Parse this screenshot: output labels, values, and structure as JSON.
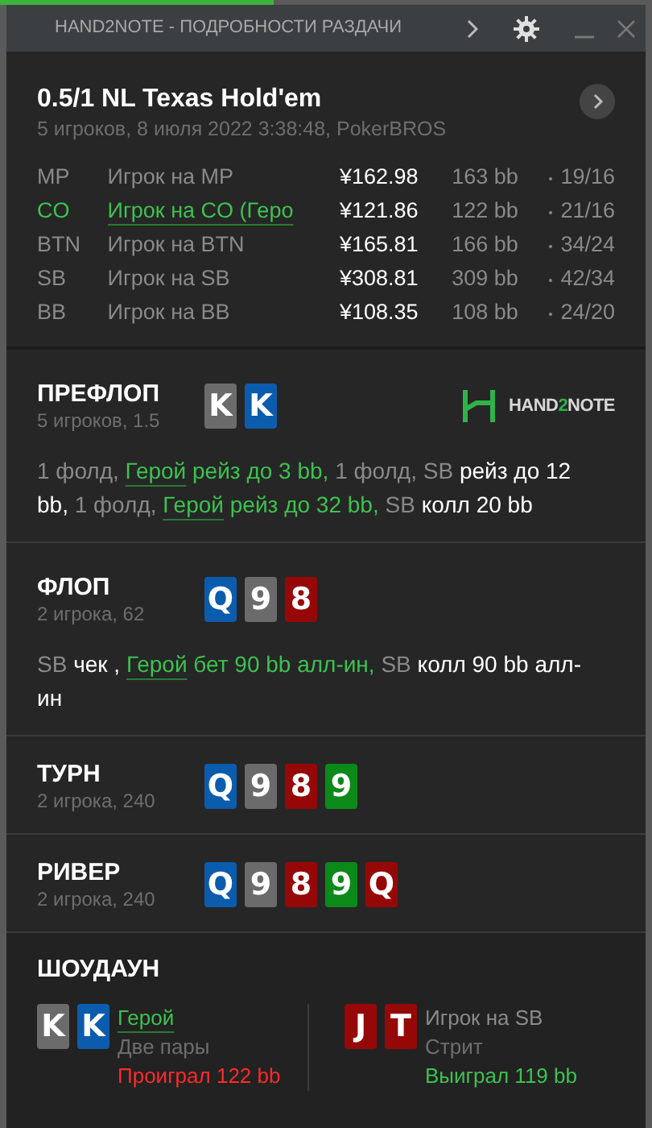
{
  "window": {
    "title": "HAND2NOTE - ПОДРОБНОСТИ РАЗДАЧИ"
  },
  "header": {
    "title": "0.5/1 NL Texas Hold'em",
    "subtitle": "5 игроков, 8 июля 2022 3:38:48, PokerBROS"
  },
  "players": [
    {
      "position": "MP",
      "name": "Игрок на MP",
      "hero": false,
      "stack": "¥162.98",
      "bb": "163 bb",
      "stats": "19/16"
    },
    {
      "position": "CO",
      "name": "Игрок на CO (Геро",
      "hero": true,
      "stack": "¥121.86",
      "bb": "122 bb",
      "stats": "21/16"
    },
    {
      "position": "BTN",
      "name": "Игрок на BTN",
      "hero": false,
      "stack": "¥165.81",
      "bb": "166 bb",
      "stats": "34/24"
    },
    {
      "position": "SB",
      "name": "Игрок на SB",
      "hero": false,
      "stack": "¥308.81",
      "bb": "309 bb",
      "stats": "42/34"
    },
    {
      "position": "BB",
      "name": "Игрок на BB",
      "hero": false,
      "stack": "¥108.35",
      "bb": "108 bb",
      "stats": "24/20"
    }
  ],
  "logo": [
    {
      "text": "HAND",
      "accent": false
    },
    {
      "text": "2",
      "accent": true
    },
    {
      "text": "NOTE",
      "accent": false
    }
  ],
  "streets": [
    {
      "name": "ПРЕФЛОП",
      "info": "5 игроков, 1.5",
      "show_logo": true,
      "cards": [
        {
          "rank": "K",
          "color": "#6b6b6b"
        },
        {
          "rank": "K",
          "color": "#0b5cad"
        }
      ],
      "actions": [
        {
          "text": "1 фолд,",
          "kind": "player"
        },
        {
          "text": "Герой",
          "kind": "hero"
        },
        {
          "text": "рейз до 3 bb,",
          "kind": "hero_action"
        },
        {
          "text": "1 фолд, SB",
          "kind": "player"
        },
        {
          "text": "рейз до 12 bb,",
          "kind": "action"
        },
        {
          "text": "1 фолд,",
          "kind": "player"
        },
        {
          "text": "Герой",
          "kind": "hero"
        },
        {
          "text": "рейз до 32 bb,",
          "kind": "hero_action"
        },
        {
          "text": "SB",
          "kind": "player"
        },
        {
          "text": "колл 20 bb",
          "kind": "action"
        }
      ]
    },
    {
      "name": "ФЛОП",
      "info": "2 игрока, 62",
      "show_logo": false,
      "cards": [
        {
          "rank": "Q",
          "color": "#0b5cad"
        },
        {
          "rank": "9",
          "color": "#6b6b6b"
        },
        {
          "rank": "8",
          "color": "#960808"
        }
      ],
      "actions": [
        {
          "text": "SB",
          "kind": "player"
        },
        {
          "text": "чек ,",
          "kind": "action"
        },
        {
          "text": "Герой",
          "kind": "hero"
        },
        {
          "text": "бет 90 bb алл-ин,",
          "kind": "hero_action"
        },
        {
          "text": "SB",
          "kind": "player"
        },
        {
          "text": "колл 90 bb алл-ин",
          "kind": "action"
        }
      ]
    },
    {
      "name": "ТУРН",
      "info": "2 игрока, 240",
      "show_logo": false,
      "cards": [
        {
          "rank": "Q",
          "color": "#0b5cad"
        },
        {
          "rank": "9",
          "color": "#6b6b6b"
        },
        {
          "rank": "8",
          "color": "#960808"
        },
        {
          "rank": "9",
          "color": "#0b8a1a"
        }
      ]
    },
    {
      "name": "РИВЕР",
      "info": "2 игрока, 240",
      "show_logo": false,
      "cards": [
        {
          "rank": "Q",
          "color": "#0b5cad"
        },
        {
          "rank": "9",
          "color": "#6b6b6b"
        },
        {
          "rank": "8",
          "color": "#960808"
        },
        {
          "rank": "9",
          "color": "#0b8a1a"
        },
        {
          "rank": "Q",
          "color": "#960808"
        }
      ]
    }
  ],
  "showdown": {
    "title": "ШОУДАУН",
    "hands": [
      {
        "player": "Герой",
        "hero": true,
        "hand": "Две пары",
        "result": "Проиграл 122 bb",
        "won": false,
        "cards": [
          {
            "rank": "K",
            "color": "#6b6b6b"
          },
          {
            "rank": "K",
            "color": "#0b5cad"
          }
        ]
      },
      {
        "player": "Игрок на SB",
        "hero": false,
        "hand": "Стрит",
        "result": "Выиграл 119 bb",
        "won": true,
        "cards": [
          {
            "rank": "J",
            "color": "#960808"
          },
          {
            "rank": "T",
            "color": "#960808"
          }
        ]
      }
    ]
  }
}
